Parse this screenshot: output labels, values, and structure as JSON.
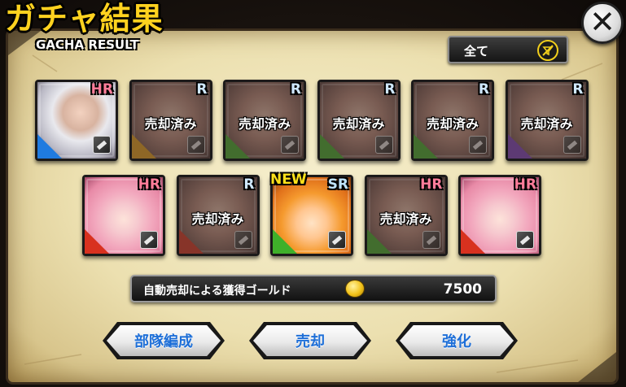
{
  "header": {
    "title_jp": "ガチャ結果",
    "title_en": "GACHA RESULT",
    "close_label": "✕"
  },
  "filter": {
    "label": "全て",
    "icon": "filter-disabled-icon"
  },
  "sold_label": "売却済み",
  "new_label": "NEW",
  "cards": [
    {
      "rarity": "HR",
      "sold": false,
      "new": false,
      "element": "blue",
      "art": "silver-hair-girl"
    },
    {
      "rarity": "R",
      "sold": true,
      "new": false,
      "element": "orange",
      "art": "character"
    },
    {
      "rarity": "R",
      "sold": true,
      "new": false,
      "element": "green",
      "art": "character"
    },
    {
      "rarity": "R",
      "sold": true,
      "new": false,
      "element": "green",
      "art": "character"
    },
    {
      "rarity": "R",
      "sold": true,
      "new": false,
      "element": "green",
      "art": "character"
    },
    {
      "rarity": "R",
      "sold": true,
      "new": false,
      "element": "purple",
      "art": "character"
    },
    {
      "rarity": "HR",
      "sold": false,
      "new": false,
      "element": "red",
      "art": "pink-hair-girl"
    },
    {
      "rarity": "R",
      "sold": true,
      "new": false,
      "element": "red",
      "art": "character"
    },
    {
      "rarity": "SR",
      "sold": false,
      "new": true,
      "element": "green",
      "art": "orange-hair-girl"
    },
    {
      "rarity": "HR",
      "sold": true,
      "new": false,
      "element": "green",
      "art": "character"
    },
    {
      "rarity": "HR",
      "sold": false,
      "new": false,
      "element": "red",
      "art": "pink-hair-girl"
    }
  ],
  "gold": {
    "label": "自動売却による獲得ゴールド",
    "value": "7500",
    "icon": "gold-coin-icon"
  },
  "buttons": [
    {
      "label": "部隊編成"
    },
    {
      "label": "売却"
    },
    {
      "label": "強化"
    }
  ],
  "colors": {
    "title": "#ffd21f",
    "button_text": "#1e6fd8",
    "panel": "#f1e6bd",
    "element_blue": "#1f7be0",
    "element_green": "#3fb02a",
    "element_orange": "#e6a21a",
    "element_purple": "#7a3fc4",
    "element_red": "#d8311f"
  }
}
